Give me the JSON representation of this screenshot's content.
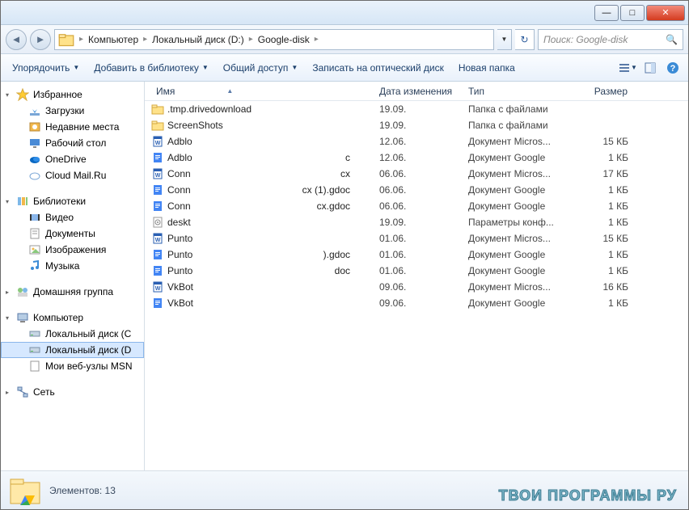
{
  "titlebar": {
    "minimize": "—",
    "maximize": "□",
    "close": "✕"
  },
  "breadcrumb": {
    "items": [
      "Компьютер",
      "Локальный диск (D:)",
      "Google-disk"
    ]
  },
  "search": {
    "placeholder": "Поиск: Google-disk"
  },
  "toolbar": {
    "organize": "Упорядочить",
    "include": "Добавить в библиотеку",
    "share": "Общий доступ",
    "burn": "Записать на оптический диск",
    "new_folder": "Новая папка"
  },
  "sidebar": {
    "favorites": {
      "label": "Избранное",
      "items": [
        {
          "label": "Загрузки",
          "icon": "download"
        },
        {
          "label": "Недавние места",
          "icon": "recent"
        },
        {
          "label": "Рабочий стол",
          "icon": "desktop"
        },
        {
          "label": "OneDrive",
          "icon": "onedrive"
        },
        {
          "label": "Cloud Mail.Ru",
          "icon": "cloud"
        }
      ]
    },
    "libraries": {
      "label": "Библиотеки",
      "items": [
        {
          "label": "Видео",
          "icon": "video"
        },
        {
          "label": "Документы",
          "icon": "docs"
        },
        {
          "label": "Изображения",
          "icon": "images"
        },
        {
          "label": "Музыка",
          "icon": "music"
        }
      ]
    },
    "homegroup": {
      "label": "Домашняя группа"
    },
    "computer": {
      "label": "Компьютер",
      "items": [
        {
          "label": "Локальный диск (C",
          "icon": "disk",
          "selected": false
        },
        {
          "label": "Локальный диск (D",
          "icon": "disk",
          "selected": true
        },
        {
          "label": "Мои веб-узлы MSN",
          "icon": "web",
          "selected": false
        }
      ]
    },
    "network": {
      "label": "Сеть"
    }
  },
  "columns": {
    "name": "Имя",
    "date": "Дата изменения",
    "type": "Тип",
    "size": "Размер"
  },
  "files": [
    {
      "icon": "folder",
      "name1": ".tmp.drivedownload",
      "name2": "",
      "date": "19.09.",
      "type": "Папка с файлами",
      "size": ""
    },
    {
      "icon": "folder",
      "name1": "ScreenShots",
      "name2": "",
      "date": "19.09.",
      "type": "Папка с файлами",
      "size": ""
    },
    {
      "icon": "word",
      "name1": "Adblo",
      "name2": "",
      "date": "12.06.",
      "type": "Документ Micros...",
      "size": "15 КБ"
    },
    {
      "icon": "gdoc",
      "name1": "Adblo",
      "name2": "c",
      "date": "12.06.",
      "type": "Документ Google",
      "size": "1 КБ"
    },
    {
      "icon": "word",
      "name1": "Conn",
      "name2": "cx",
      "date": "06.06.",
      "type": "Документ Micros...",
      "size": "17 КБ"
    },
    {
      "icon": "gdoc",
      "name1": "Conn",
      "name2": "cx (1).gdoc",
      "date": "06.06.",
      "type": "Документ Google",
      "size": "1 КБ"
    },
    {
      "icon": "gdoc",
      "name1": "Conn",
      "name2": "cx.gdoc",
      "date": "06.06.",
      "type": "Документ Google",
      "size": "1 КБ"
    },
    {
      "icon": "ini",
      "name1": "deskt",
      "name2": "",
      "date": "19.09.",
      "type": "Параметры конф...",
      "size": "1 КБ"
    },
    {
      "icon": "word",
      "name1": "Punto",
      "name2": "",
      "date": "01.06.",
      "type": "Документ Micros...",
      "size": "15 КБ"
    },
    {
      "icon": "gdoc",
      "name1": "Punto",
      "name2": ").gdoc",
      "date": "01.06.",
      "type": "Документ Google",
      "size": "1 КБ"
    },
    {
      "icon": "gdoc",
      "name1": "Punto",
      "name2": "doc",
      "date": "01.06.",
      "type": "Документ Google",
      "size": "1 КБ"
    },
    {
      "icon": "word",
      "name1": "VkBot",
      "name2": "",
      "date": "09.06.",
      "type": "Документ Micros...",
      "size": "16 КБ"
    },
    {
      "icon": "gdoc",
      "name1": "VkBot",
      "name2": "",
      "date": "09.06.",
      "type": "Документ Google",
      "size": "1 КБ"
    }
  ],
  "status": {
    "text": "Элементов: 13"
  },
  "watermark": "ТВОИ ПРОГРАММЫ РУ"
}
